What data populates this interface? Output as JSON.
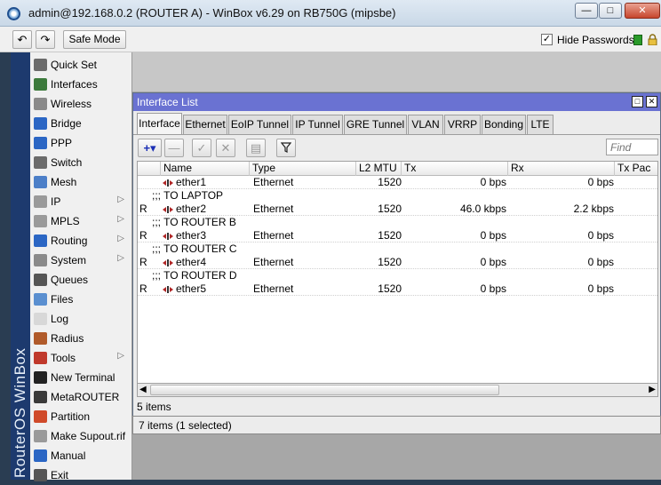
{
  "window": {
    "title": "admin@192.168.0.2 (ROUTER A) - WinBox v6.29 on RB750G (mipsbe)",
    "min_label": "—",
    "max_label": "□",
    "close_label": "✕"
  },
  "toolbar": {
    "undo_label": "↶",
    "redo_label": "↷",
    "safe_mode_label": "Safe Mode",
    "hide_passwords_label": "Hide Passwords",
    "hide_passwords_checked": "✓"
  },
  "brand": "RouterOS WinBox",
  "sidebar": {
    "items": [
      {
        "label": "Quick Set",
        "icon": "quick-set-icon",
        "color": "#6b6b6b",
        "submenu": ""
      },
      {
        "label": "Interfaces",
        "icon": "interfaces-icon",
        "color": "#3c7a3c",
        "submenu": ""
      },
      {
        "label": "Wireless",
        "icon": "wireless-icon",
        "color": "#8a8a8a",
        "submenu": ""
      },
      {
        "label": "Bridge",
        "icon": "bridge-icon",
        "color": "#2b66c4",
        "submenu": ""
      },
      {
        "label": "PPP",
        "icon": "ppp-icon",
        "color": "#2b66c4",
        "submenu": ""
      },
      {
        "label": "Switch",
        "icon": "switch-icon",
        "color": "#6b6b6b",
        "submenu": ""
      },
      {
        "label": "Mesh",
        "icon": "mesh-icon",
        "color": "#4c7fc8",
        "submenu": ""
      },
      {
        "label": "IP",
        "icon": "ip-icon",
        "color": "#9a9a9a",
        "submenu": "▷"
      },
      {
        "label": "MPLS",
        "icon": "mpls-icon",
        "color": "#9a9a9a",
        "submenu": "▷"
      },
      {
        "label": "Routing",
        "icon": "routing-icon",
        "color": "#2b66c4",
        "submenu": "▷"
      },
      {
        "label": "System",
        "icon": "system-icon",
        "color": "#8a8a8a",
        "submenu": "▷"
      },
      {
        "label": "Queues",
        "icon": "queues-icon",
        "color": "#555555",
        "submenu": ""
      },
      {
        "label": "Files",
        "icon": "files-icon",
        "color": "#5a8fd0",
        "submenu": ""
      },
      {
        "label": "Log",
        "icon": "log-icon",
        "color": "#d8d8d8",
        "submenu": ""
      },
      {
        "label": "Radius",
        "icon": "radius-icon",
        "color": "#b05a2a",
        "submenu": ""
      },
      {
        "label": "Tools",
        "icon": "tools-icon",
        "color": "#c0392b",
        "submenu": "▷"
      },
      {
        "label": "New Terminal",
        "icon": "terminal-icon",
        "color": "#222222",
        "submenu": ""
      },
      {
        "label": "MetaROUTER",
        "icon": "metarouter-icon",
        "color": "#3a3a3a",
        "submenu": ""
      },
      {
        "label": "Partition",
        "icon": "partition-icon",
        "color": "#d04a2a",
        "submenu": ""
      },
      {
        "label": "Make Supout.rif",
        "icon": "supout-icon",
        "color": "#9a9a9a",
        "submenu": ""
      },
      {
        "label": "Manual",
        "icon": "manual-icon",
        "color": "#2b66c4",
        "submenu": ""
      },
      {
        "label": "Exit",
        "icon": "exit-icon",
        "color": "#555555",
        "submenu": ""
      }
    ]
  },
  "iface_window": {
    "title": "Interface List",
    "max_label": "□",
    "close_label": "✕",
    "tabs": [
      "Interface",
      "Ethernet",
      "EoIP Tunnel",
      "IP Tunnel",
      "GRE Tunnel",
      "VLAN",
      "VRRP",
      "Bonding",
      "LTE"
    ],
    "find_placeholder": "Find",
    "columns": {
      "name": "Name",
      "type": "Type",
      "mtu": "L2 MTU",
      "tx": "Tx",
      "rx": "Rx",
      "txpac": "Tx Pac"
    },
    "rows": [
      {
        "kind": "data",
        "flag": "",
        "name": "ether1",
        "type": "Ethernet",
        "mtu": "1520",
        "tx": "0 bps",
        "rx": "0 bps"
      },
      {
        "kind": "comment",
        "text": ";;; TO LAPTOP"
      },
      {
        "kind": "data",
        "flag": "R",
        "name": "ether2",
        "type": "Ethernet",
        "mtu": "1520",
        "tx": "46.0 kbps",
        "rx": "2.2 kbps"
      },
      {
        "kind": "comment",
        "text": ";;; TO ROUTER B"
      },
      {
        "kind": "data",
        "flag": "R",
        "name": "ether3",
        "type": "Ethernet",
        "mtu": "1520",
        "tx": "0 bps",
        "rx": "0 bps"
      },
      {
        "kind": "comment",
        "text": ";;; TO ROUTER C"
      },
      {
        "kind": "data",
        "flag": "R",
        "name": "ether4",
        "type": "Ethernet",
        "mtu": "1520",
        "tx": "0 bps",
        "rx": "0 bps"
      },
      {
        "kind": "comment",
        "text": ";;; TO ROUTER D"
      },
      {
        "kind": "data",
        "flag": "R",
        "name": "ether5",
        "type": "Ethernet",
        "mtu": "1520",
        "tx": "0 bps",
        "rx": "0 bps"
      }
    ],
    "item_count": "5 items",
    "status": "7 items (1 selected)"
  }
}
